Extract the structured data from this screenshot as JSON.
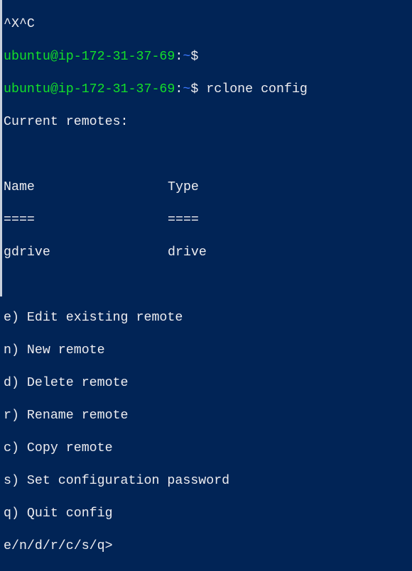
{
  "terminal": {
    "line0": "^X^C",
    "prompt_user_host": "ubuntu@ip-172-31-37-69",
    "prompt_colon": ":",
    "prompt_tilde": "~",
    "prompt_dollar": "$",
    "command": " rclone config",
    "current_remotes": "Current remotes:",
    "header_name": "Name",
    "header_type": "Type",
    "sep_name": "====",
    "sep_type": "====",
    "remotes": [
      {
        "name": "gdrive",
        "type": "drive"
      }
    ],
    "menu": [
      "e) Edit existing remote",
      "n) New remote",
      "d) Delete remote",
      "r) Rename remote",
      "c) Copy remote",
      "s) Set configuration password",
      "q) Quit config"
    ],
    "input_prompt": "e/n/d/r/c/s/q>"
  },
  "colors": {
    "background": "#012456",
    "prompt": "#13e029",
    "tilde": "#3b78ff",
    "text": "#eeedf0"
  }
}
